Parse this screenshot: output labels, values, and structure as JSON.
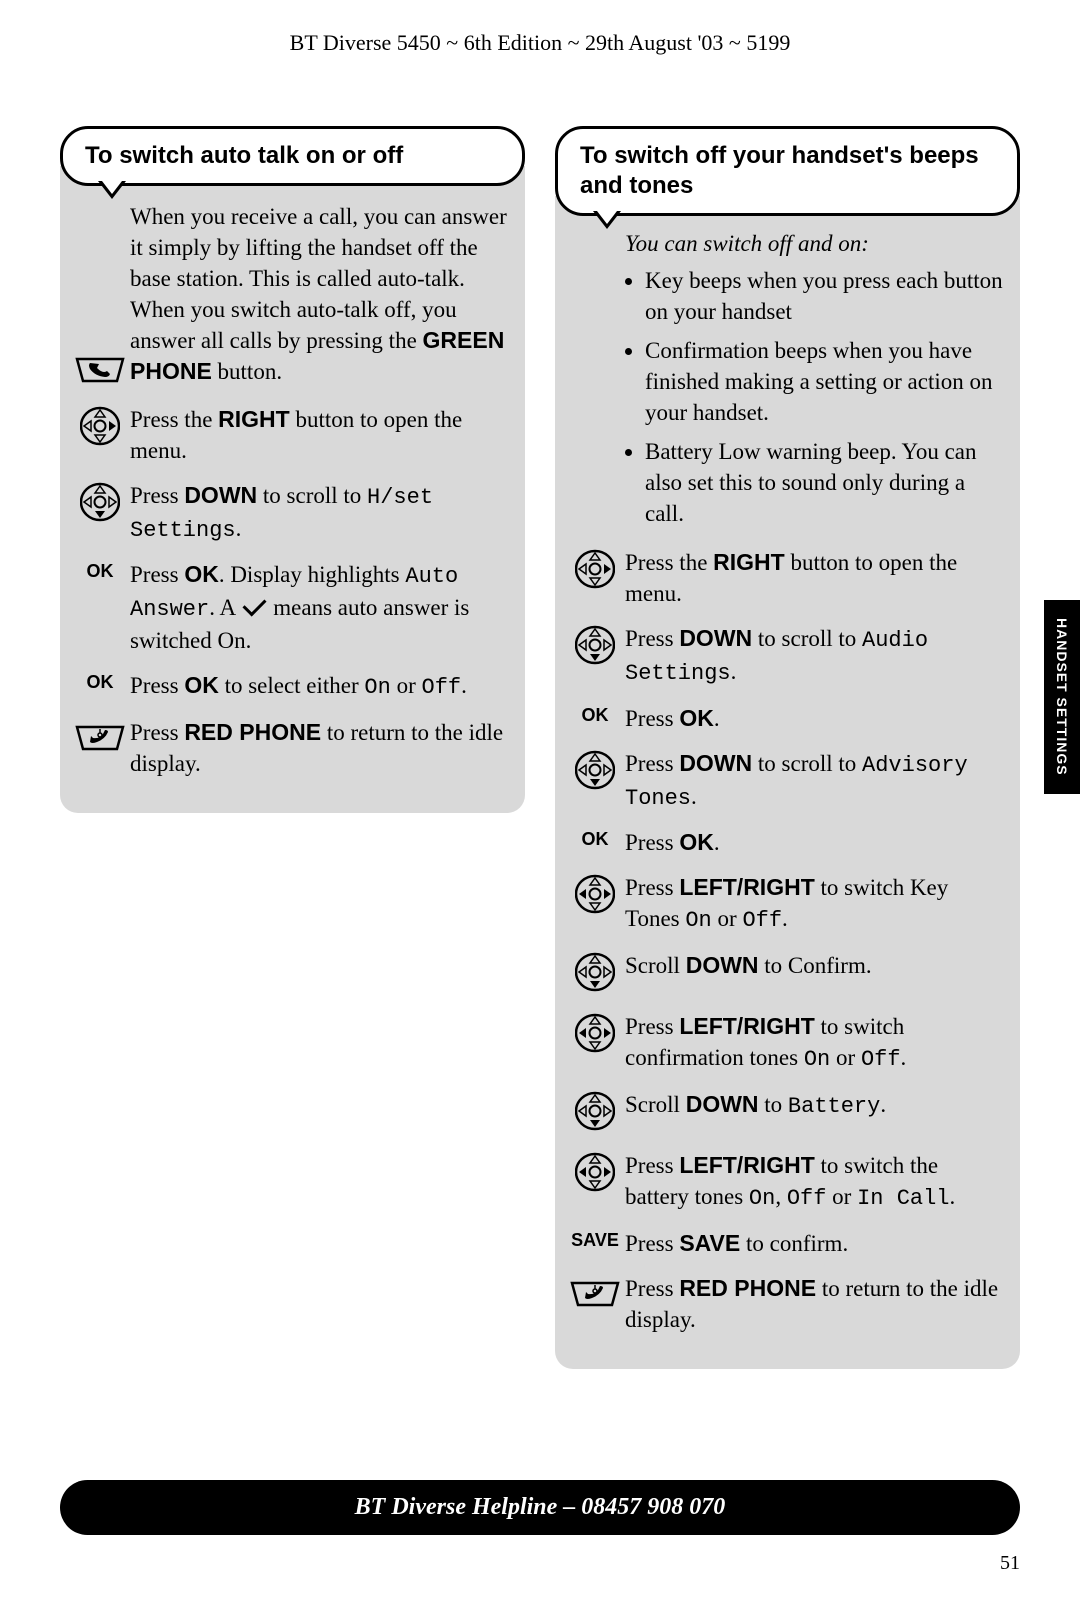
{
  "header": "BT Diverse 5450 ~ 6th Edition ~ 29th August '03 ~ 5199",
  "side_tab": "HANDSET SETTINGS",
  "helpline": "BT Diverse Helpline – 08457 908 070",
  "page_number": "51",
  "left": {
    "title": "To switch auto talk on or off",
    "intro_pre": "When you receive a call, you can answer it simply by lifting the handset off the base station. This is called auto-talk. When you switch auto-talk off, you answer all calls by pressing the ",
    "intro_bold": "GREEN PHONE",
    "intro_post": " button.",
    "steps": {
      "s1": {
        "pre": "Press the ",
        "b": "RIGHT",
        "post": " button to open the menu."
      },
      "s2": {
        "pre": "Press ",
        "b": "DOWN",
        "mid": " to scroll to ",
        "lcd": "H/set Settings",
        "post": "."
      },
      "s3": {
        "label": "OK",
        "pre": "Press ",
        "b": "OK",
        "mid": ". Display highlights ",
        "lcd": "Auto Answer",
        "mid2": ". A ",
        "post": " means auto answer is switched On."
      },
      "s4": {
        "label": "OK",
        "pre": "Press ",
        "b": "OK",
        "mid": " to select either ",
        "lcd1": "On",
        "mid2": " or ",
        "lcd2": "Off",
        "post": "."
      },
      "s5": {
        "pre": "Press ",
        "b": "RED PHONE",
        "post": " to return to the idle display."
      }
    }
  },
  "right": {
    "title": "To switch off your handset's beeps and tones",
    "intro_italic": "You can switch off and on:",
    "bullets": {
      "b1": "Key beeps when you press each button on your handset",
      "b2": "Confirmation beeps when you have finished making a setting or action on your handset.",
      "b3": "Battery Low warning beep. You can also set this to sound only during a call."
    },
    "steps": {
      "s1": {
        "pre": "Press the ",
        "b": "RIGHT",
        "post": " button to open the menu."
      },
      "s2": {
        "pre": "Press ",
        "b": "DOWN",
        "mid": " to scroll to ",
        "lcd": "Audio Settings",
        "post": "."
      },
      "s3": {
        "label": "OK",
        "pre": "Press ",
        "b": "OK",
        "post": "."
      },
      "s4": {
        "pre": "Press ",
        "b": "DOWN",
        "mid": " to scroll to ",
        "lcd": "Advisory Tones",
        "post": "."
      },
      "s5": {
        "label": "OK",
        "pre": "Press ",
        "b": "OK",
        "post": "."
      },
      "s6": {
        "pre": "Press ",
        "b": "LEFT/RIGHT",
        "mid": " to switch Key Tones ",
        "lcd1": "On",
        "mid2": " or ",
        "lcd2": "Off",
        "post": "."
      },
      "s7": {
        "pre": "Scroll ",
        "b": "DOWN",
        "post": " to Confirm."
      },
      "s8": {
        "pre": "Press ",
        "b": "LEFT/RIGHT",
        "mid": " to switch confirmation tones ",
        "lcd1": "On",
        "mid2": " or ",
        "lcd2": "Off",
        "post": "."
      },
      "s9": {
        "pre": "Scroll ",
        "b": "DOWN",
        "mid": " to ",
        "lcd": "Battery",
        "post": "."
      },
      "s10": {
        "pre": "Press ",
        "b": "LEFT/RIGHT",
        "mid": " to switch the battery tones ",
        "lcd1": "On",
        "mid2": ", ",
        "lcd2": "Off",
        "mid3": " or ",
        "lcd3": "In Call",
        "post": "."
      },
      "s11": {
        "label": "SAVE",
        "pre": "Press ",
        "b": "SAVE",
        "post": " to confirm."
      },
      "s12": {
        "pre": "Press ",
        "b": "RED PHONE",
        "post": " to return to the idle display."
      }
    }
  }
}
